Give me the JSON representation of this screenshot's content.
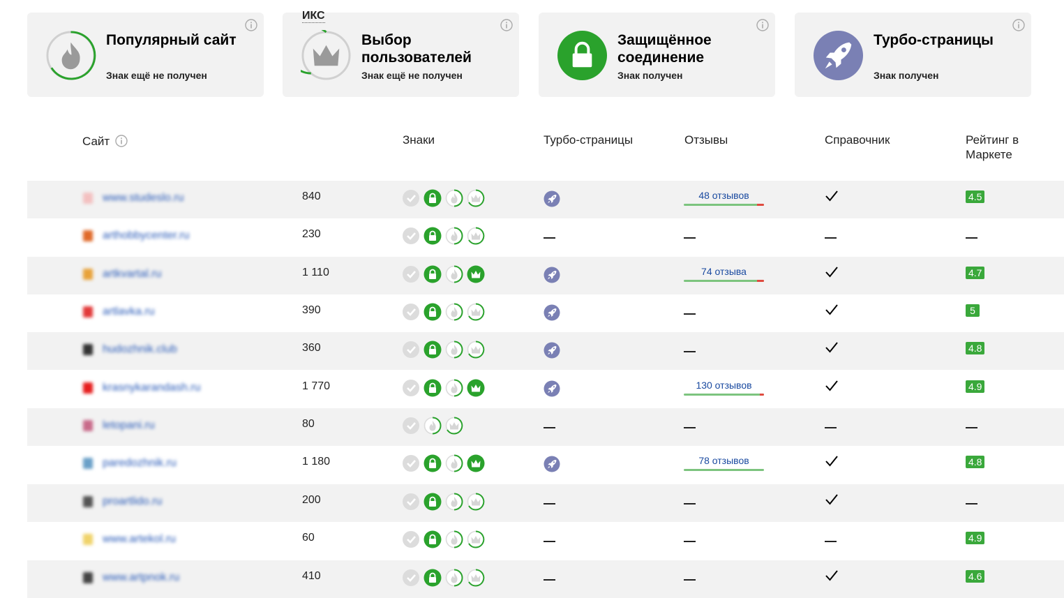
{
  "badges": [
    {
      "title": "Популярный сайт",
      "status": "Знак ещё не получен",
      "icon": "flame-icon"
    },
    {
      "title": "Выбор пользователей",
      "status": "Знак ещё не получен",
      "icon": "crown-icon"
    },
    {
      "title": "Защищённое соединение",
      "status": "Знак получен",
      "icon": "lock-icon"
    },
    {
      "title": "Турбо-страницы",
      "status": "Знак получен",
      "icon": "rocket-icon"
    }
  ],
  "table": {
    "headers": {
      "site": "Сайт",
      "iks": "ИКС",
      "signs": "Знаки",
      "turbo": "Турбо-страницы",
      "reviews": "Отзывы",
      "directory": "Справочник",
      "market_rating": "Рейтинг в Маркете"
    },
    "rows": [
      {
        "site": "www.studeslo.ru",
        "fav_color": "#f3c0c0",
        "iks": "840",
        "signs": [
          "check-grey",
          "lock",
          "flame-partial",
          "crown-partial"
        ],
        "turbo": true,
        "reviews": "48 отзывов",
        "neg": 10,
        "directory": true,
        "rating": "4.5"
      },
      {
        "site": "arthobbycenter.ru",
        "fav_color": "#e06a2a",
        "iks": "230",
        "signs": [
          "check-grey",
          "lock",
          "flame-partial",
          "crown-partial"
        ],
        "turbo": false,
        "reviews": null,
        "neg": 0,
        "directory": false,
        "rating": null
      },
      {
        "site": "artkvartal.ru",
        "fav_color": "#e8a23a",
        "iks": "1 110",
        "signs": [
          "check-grey",
          "lock",
          "flame-partial",
          "crown-green"
        ],
        "turbo": true,
        "reviews": "74 отзыва",
        "neg": 10,
        "directory": true,
        "rating": "4.7"
      },
      {
        "site": "artlavka.ru",
        "fav_color": "#e23a3a",
        "iks": "390",
        "signs": [
          "check-grey",
          "lock",
          "flame-partial",
          "crown-partial"
        ],
        "turbo": true,
        "reviews": null,
        "neg": 0,
        "directory": true,
        "rating": "5"
      },
      {
        "site": "hudozhnik.club",
        "fav_color": "#333333",
        "iks": "360",
        "signs": [
          "check-grey",
          "lock",
          "flame-partial",
          "crown-partial"
        ],
        "turbo": true,
        "reviews": null,
        "neg": 0,
        "directory": true,
        "rating": "4.8"
      },
      {
        "site": "krasnykarandash.ru",
        "fav_color": "#e61e1e",
        "iks": "1 770",
        "signs": [
          "check-grey",
          "lock",
          "flame-partial",
          "crown-green"
        ],
        "turbo": true,
        "reviews": "130 отзывов",
        "neg": 6,
        "directory": true,
        "rating": "4.9"
      },
      {
        "site": "letopani.ru",
        "fav_color": "#c86a8a",
        "iks": "80",
        "signs": [
          "check-grey",
          "flame-partial",
          "crown-partial"
        ],
        "turbo": false,
        "reviews": null,
        "neg": 0,
        "directory": false,
        "rating": null
      },
      {
        "site": "paredozhnik.ru",
        "fav_color": "#6aa0c8",
        "iks": "1 180",
        "signs": [
          "check-grey",
          "lock",
          "flame-partial",
          "crown-green"
        ],
        "turbo": true,
        "reviews": "78 отзывов",
        "neg": 0,
        "directory": true,
        "rating": "4.8"
      },
      {
        "site": "proartlido.ru",
        "fav_color": "#555555",
        "iks": "200",
        "signs": [
          "check-grey",
          "lock",
          "flame-partial",
          "crown-partial"
        ],
        "turbo": false,
        "reviews": null,
        "neg": 0,
        "directory": true,
        "rating": null
      },
      {
        "site": "www.artekol.ru",
        "fav_color": "#f0d36a",
        "iks": "60",
        "signs": [
          "check-grey",
          "lock",
          "flame-partial",
          "crown-partial"
        ],
        "turbo": false,
        "reviews": null,
        "neg": 0,
        "directory": false,
        "rating": "4.9"
      },
      {
        "site": "www.artpnok.ru",
        "fav_color": "#444444",
        "iks": "410",
        "signs": [
          "check-grey",
          "lock",
          "flame-partial",
          "crown-partial"
        ],
        "turbo": false,
        "reviews": null,
        "neg": 0,
        "directory": true,
        "rating": "4.6"
      }
    ]
  },
  "colors": {
    "green": "#2aa22c",
    "turbo": "#7a80b4",
    "card_bg": "#f2f2f2",
    "link": "#1a4aa0"
  }
}
